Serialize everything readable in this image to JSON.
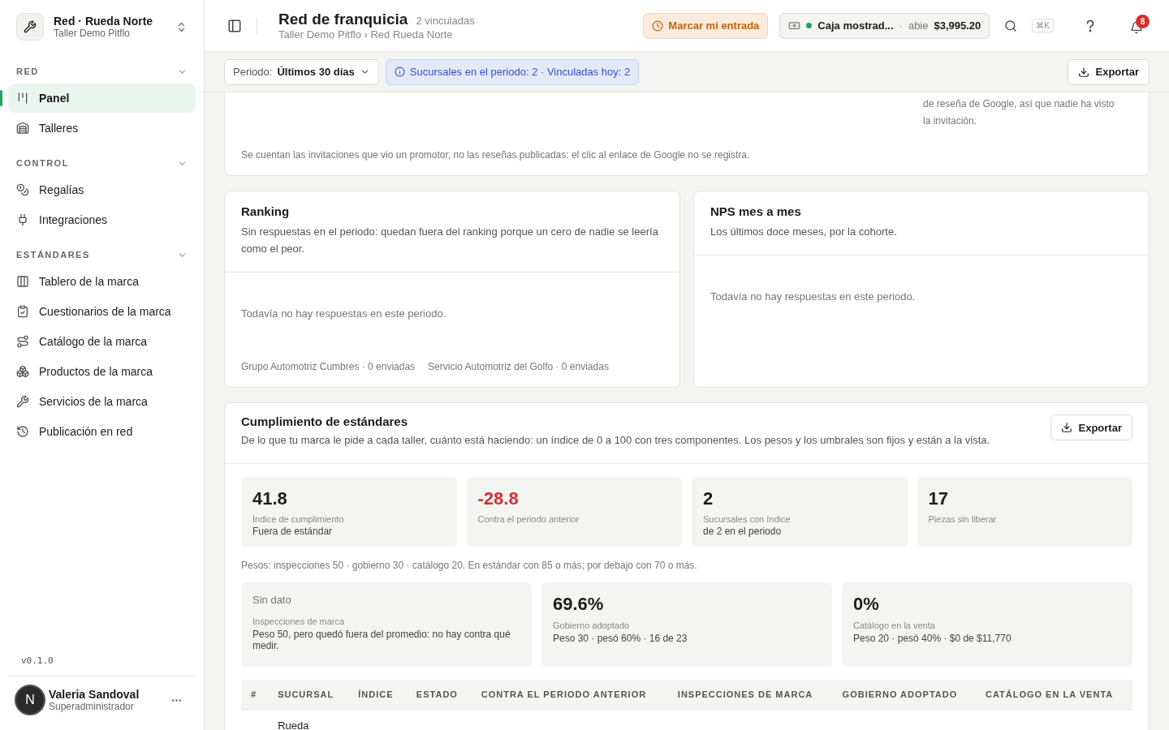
{
  "workspace": {
    "name": "Red · Rueda Norte",
    "subtitle": "Taller Demo Pitflo"
  },
  "sidebar": {
    "sections": [
      {
        "title": "RED",
        "expanded": true,
        "items": [
          {
            "label": "Panel",
            "selected": true
          },
          {
            "label": "Talleres",
            "selected": false
          }
        ]
      },
      {
        "title": "CONTROL",
        "expanded": true,
        "items": [
          {
            "label": "Regalías",
            "selected": false
          },
          {
            "label": "Integraciones",
            "selected": false
          }
        ]
      },
      {
        "title": "ESTÁNDARES",
        "expanded": true,
        "items": [
          {
            "label": "Tablero de la marca",
            "selected": false
          },
          {
            "label": "Cuestionarios de la marca",
            "selected": false
          },
          {
            "label": "Catálogo de la marca",
            "selected": false
          },
          {
            "label": "Productos de la marca",
            "selected": false
          },
          {
            "label": "Servicios de la marca",
            "selected": false
          },
          {
            "label": "Publicación en red",
            "selected": false
          }
        ]
      }
    ],
    "version": "v0.1.0",
    "user": {
      "initial": "N",
      "name": "Valeria Sandoval",
      "role": "Superadministrador"
    }
  },
  "header": {
    "title": "Red de franquicia",
    "count": "2 vinculadas",
    "breadcrumb": "Taller Demo Pitflo › Red Rueda Norte",
    "clock_button": "Marcar mi entrada",
    "register": {
      "name": "Caja mostrad...",
      "separator": "·",
      "status": "abie",
      "amount": "$3,995.20",
      "open": true
    },
    "shortcut": "⌘K",
    "notifications": "8"
  },
  "toolbar": {
    "period_label": "Periodo:",
    "period_value": "Últimos 30 días",
    "info": "Sucursales en el periodo: 2 · Vinculadas hoy: 2",
    "export": "Exportar"
  },
  "invitations_card": {
    "note_lines": [
      "de reseña de Google, así que nadie ha visto",
      "la invitación."
    ],
    "footer": "Se cuentan las invitaciones que vio un promotor, no las reseñas publicadas: el clic al enlace de Google no se registra."
  },
  "ranking": {
    "title": "Ranking",
    "description": "Sin respuestas en el periodo: quedan fuera del ranking porque un cero de nadie se leería como el peor.",
    "empty": "Todavía no hay respuestas en este periodo.",
    "branches": [
      "Grupo Automotriz Cumbres · 0 enviadas",
      "Servicio Automotriz del Golfo · 0 enviadas"
    ]
  },
  "nps": {
    "title": "NPS mes a mes",
    "description": "Los últimos doce meses, por la cohorte.",
    "empty": "Todavía no hay respuestas en este periodo."
  },
  "compliance": {
    "title": "Cumplimiento de estándares",
    "description": "De lo que tu marca le pide a cada taller, cuánto está haciendo: un índice de 0 a 100 con tres componentes. Los pesos y los umbrales son fijos y están a la vista.",
    "export": "Exportar",
    "stats": [
      {
        "value": "41.8",
        "label": "Índice de cumplimiento",
        "detail": "Fuera de estándar",
        "negative": false
      },
      {
        "value": "-28.8",
        "label": "Contra el periodo anterior",
        "negative": true
      },
      {
        "value": "2",
        "label": "Sucursales con índice",
        "detail": "de 2 en el periodo",
        "negative": false
      },
      {
        "value": "17",
        "label": "Piezas sin liberar",
        "negative": false
      }
    ],
    "weights_note": "Pesos: inspecciones 50 · gobierno 30 · catálogo 20. En estándar con 85 o más; por debajo con 70 o más.",
    "components": [
      {
        "value": "Sin dato",
        "label": "Inspecciones de marca",
        "detail": "Peso 50, pero quedó fuera del promedio: no hay contra qué medir.",
        "has_data": false
      },
      {
        "value": "69.6%",
        "label": "Gobierno adoptado",
        "detail": "Peso 30 · pesó 60% · 16 de 23",
        "has_data": true
      },
      {
        "value": "0%",
        "label": "Catálogo en la venta",
        "detail": "Peso 20 · pesó 40% · $0 de $11,770",
        "has_data": true
      }
    ],
    "table": {
      "columns": [
        "#",
        "SUCURSAL",
        "ÍNDICE",
        "ESTADO",
        "CONTRA EL PERIODO ANTERIOR",
        "INSPECCIONES DE MARCA",
        "GOBIERNO ADOPTADO",
        "CATÁLOGO EN LA VENTA"
      ],
      "rows": [
        {
          "branch": "Rueda"
        }
      ]
    }
  }
}
